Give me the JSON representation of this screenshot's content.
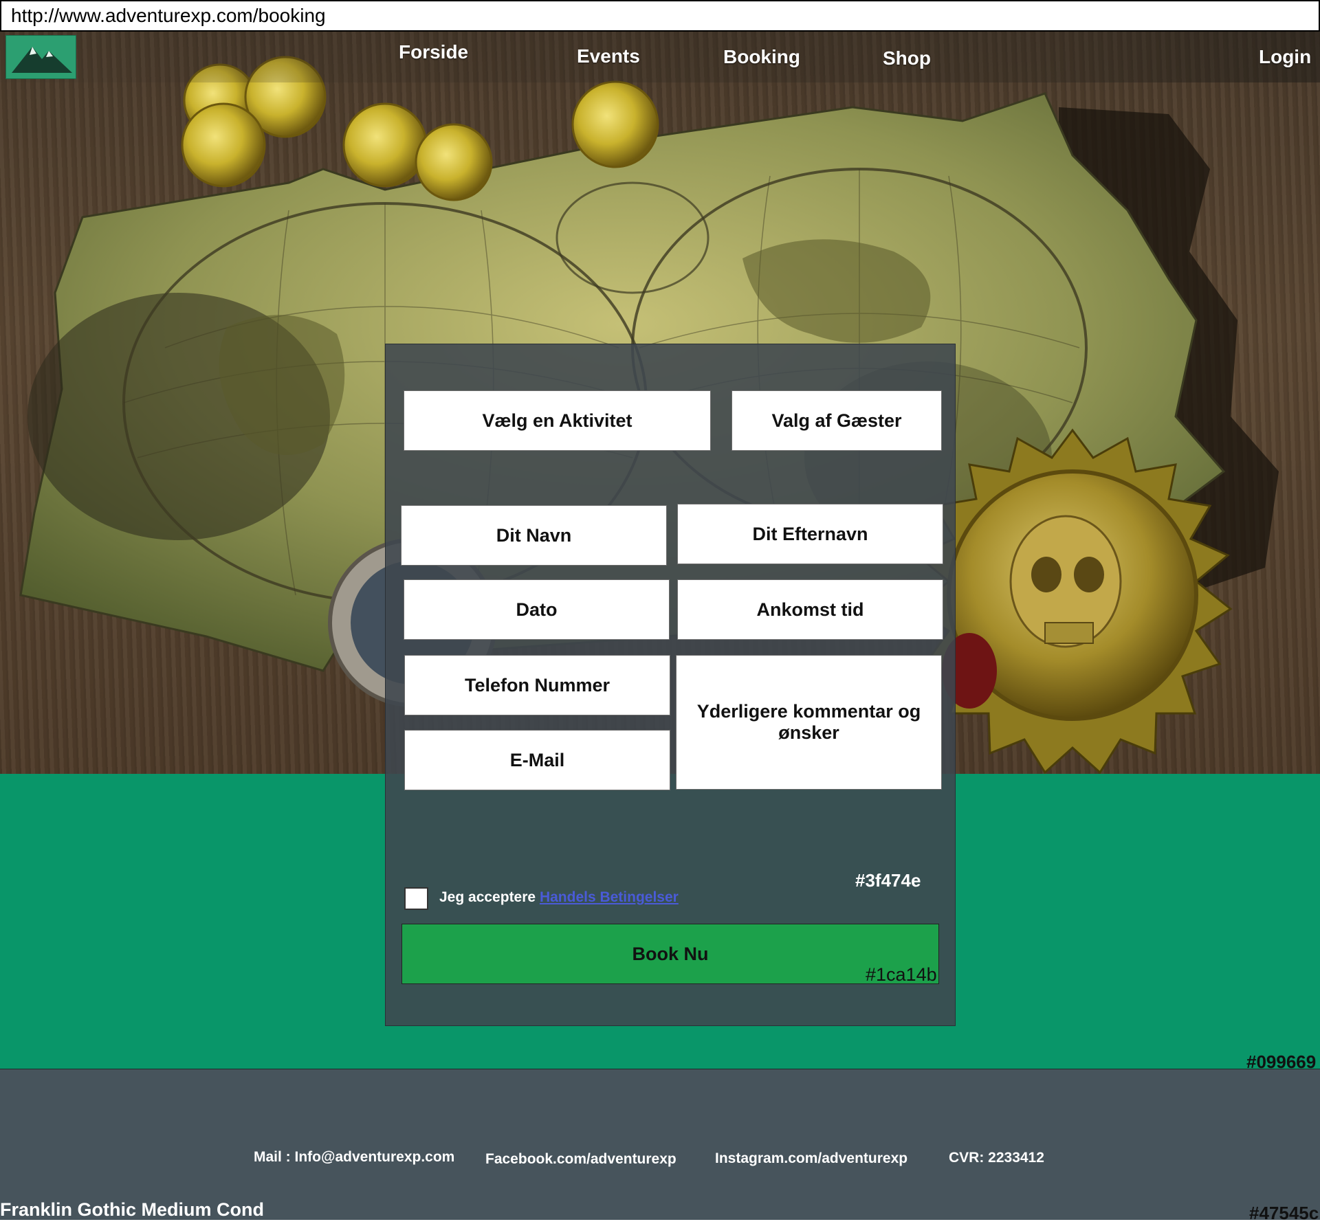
{
  "browser": {
    "url": "http://www.adventurexp.com/booking"
  },
  "nav": {
    "logo_icon": "mountain-logo",
    "items": [
      {
        "label": "Forside"
      },
      {
        "label": "Events"
      },
      {
        "label": "Booking"
      },
      {
        "label": "Shop"
      }
    ],
    "login_label": "Login"
  },
  "form": {
    "activity_label": "Vælg en Aktivitet",
    "guests_label": "Valg af Gæster",
    "first_name_label": "Dit Navn",
    "last_name_label": "Dit Efternavn",
    "date_label": "Dato",
    "arrival_label": "Ankomst tid",
    "phone_label": "Telefon Nummer",
    "email_label": "E-Mail",
    "comments_label": "Yderligere kommentar og ønsker",
    "accept_prefix": "Jeg acceptere",
    "terms_link": "Handels Betingelser",
    "submit_label": "Book Nu"
  },
  "annotations": {
    "panel_color": "#3f474e",
    "button_color": "#1ca14b",
    "band_color": "#099669",
    "footer_color": "#47545c",
    "font_note": "Franklin Gothic Medium Cond"
  },
  "footer": {
    "mail": "Mail : Info@adventurexp.com",
    "facebook": "Facebook.com/adventurexp",
    "instagram": "Instagram.com/adventurexp",
    "cvr": "CVR: 2233412"
  },
  "colors": {
    "panel": "#3f474e",
    "button": "#1ca14b",
    "band": "#099669",
    "footer": "#47545c",
    "logo": "#2c9f71",
    "link": "#4a5bd8"
  }
}
